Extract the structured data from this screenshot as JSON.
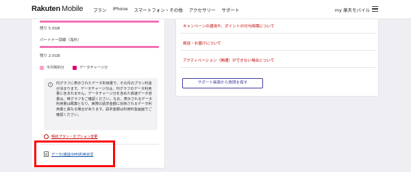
{
  "header": {
    "logo_brand": "Rakuten",
    "logo_suffix": "Mobile",
    "nav": [
      "プラン",
      "iPhone",
      "スマートフォン・その他",
      "アクセサリー",
      "サポート"
    ],
    "user_label": "my 楽天モバイル"
  },
  "usage": {
    "remaining_label_1": "残り 5.0GB",
    "partner_label": "パートナー回線（海外）",
    "remaining_label_2": "残り 2.0GB",
    "legend_current": "今月契約分",
    "legend_charge": "データチャージ分"
  },
  "info_text": "円グラフに表示されたデータ利用量で、その月のプラン料金が決まります。データチャージ分は、円グラフのデータ利用量に含まれません。データチャージ分を含めた高速データ容量は、棒グラフをご確認ください。なお、表示されるデータ利用量は概算となり、実際の請求金額に反映されるデータ利用量と異なる場合があります。請求金額は利用料金画面でご確認ください。",
  "links": {
    "plan_change": "契約プラン・オプション変更",
    "usage_status": "データ/通話/SMS利用状況"
  },
  "right_panel": {
    "links": [
      "キャンペーンの適用や、ポイントの付与時期について",
      "発送・お届けについて",
      "アクティベーション（開通）ができない場合について"
    ],
    "back_button": "サポート画面から質問を探す"
  },
  "colors": {
    "brand_red": "#bf0000",
    "bar_pink": "#f36fb3",
    "charge_magenta": "#e0006b",
    "highlight_red": "#ff0000"
  }
}
